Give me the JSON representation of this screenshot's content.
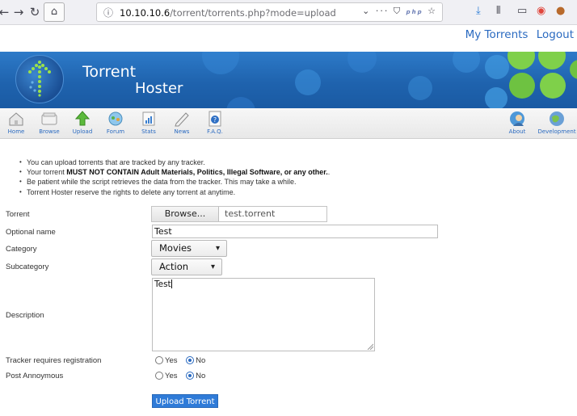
{
  "browser": {
    "url_host": "10.10.10.6",
    "url_path": "/torrent/torrents.php?mode=upload",
    "page_actions": "···",
    "php_badge": "php"
  },
  "header": {
    "links": [
      "My Torrents",
      "Logout"
    ],
    "title_line1": "Torrent",
    "title_line2": "Hoster"
  },
  "toolbar": {
    "left_items": [
      "Home",
      "Browse",
      "Upload",
      "Forum",
      "Stats",
      "News",
      "F.A.Q."
    ],
    "right_items": [
      "About",
      "Development"
    ]
  },
  "notes": {
    "line1": "You can upload torrents that are tracked by any tracker.",
    "line2_prefix": "Your torrent ",
    "line2_bold": "MUST NOT CONTAIN Adult Materials, Politics, Illegal Software, or any other.",
    "line2_suffix": ".",
    "line3": "Be patient while the script retrieves the data from the tracker. This may take a while.",
    "line4": "Torrent Hoster reserve the rights to delete any torrent at anytime."
  },
  "form": {
    "torrent_label": "Torrent",
    "browse_label": "Browse...",
    "file_name": "test.torrent",
    "optional_name_label": "Optional name",
    "optional_name_value": "Test",
    "category_label": "Category",
    "category_value": "Movies",
    "subcategory_label": "Subcategory",
    "subcategory_value": "Action",
    "description_label": "Description",
    "description_value": "Test",
    "tracker_label": "Tracker requires registration",
    "post_anon_label": "Post Annoymous",
    "yes_label": "Yes",
    "no_label": "No",
    "tracker_selected": "No",
    "post_anon_selected": "No",
    "submit_label": "Upload Torrent"
  },
  "colors": {
    "accent": "#2a6ac0",
    "banner": "#1f63ae",
    "button": "#2f7bd8"
  }
}
